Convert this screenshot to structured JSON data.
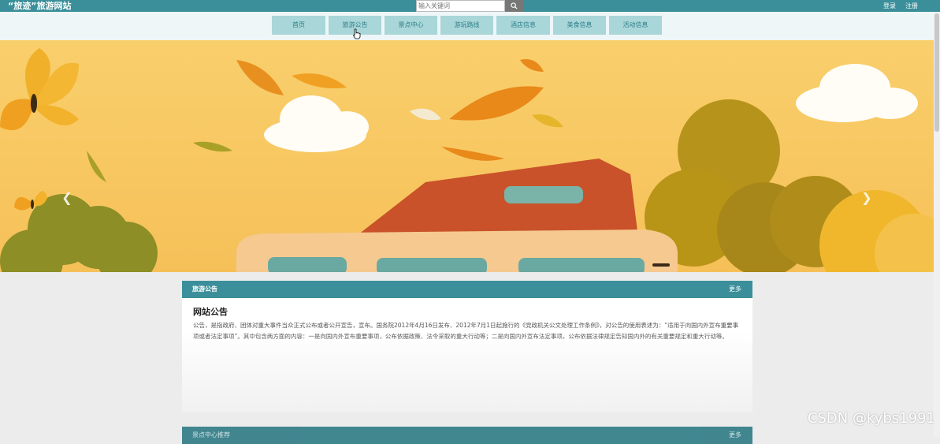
{
  "header": {
    "site_title": "“旅迹”旅游网站",
    "search_placeholder": "输入关键词",
    "search_icon": "search-icon",
    "login_label": "登录",
    "register_label": "注册"
  },
  "nav": {
    "items": [
      {
        "label": "首页"
      },
      {
        "label": "旅游公告"
      },
      {
        "label": "景点中心"
      },
      {
        "label": "游玩路线"
      },
      {
        "label": "酒店信息"
      },
      {
        "label": "美食信息"
      },
      {
        "label": "活动信息"
      }
    ]
  },
  "banner": {
    "prev_icon": "chevron-left-icon",
    "next_icon": "chevron-right-icon",
    "slide_count": 3,
    "active_slide": 2
  },
  "notice_section": {
    "header_title": "旅游公告",
    "more_label": "更多",
    "heading": "网站公告",
    "body": "公告，是指政府、团体对重大事件当众正式公布或者公开宣告，宣布。国务院2012年4月16日发布、2012年7月1日起施行的《党政机关公文处理工作条例》，对公告的使用表述为：“适用于向国内外宣布重要事项或者法定事项”。其中包含两方面的内容：一是向国内外宣布重要事项，公布依据政策、法令采取的重大行动等；二是向国内外宣布法定事项，公布依据法律规定告知国内外的有关重要规定和重大行动等。"
  },
  "attractions_section": {
    "header_title": "景点中心推荐",
    "more_label": "更多"
  },
  "watermark": "CSDN @kybs1991",
  "colors": {
    "primary": "#3a8f9a",
    "nav_item_bg": "#a9d6d8",
    "nav_text": "#2d7f8a",
    "banner_sky": "#f7c763"
  }
}
